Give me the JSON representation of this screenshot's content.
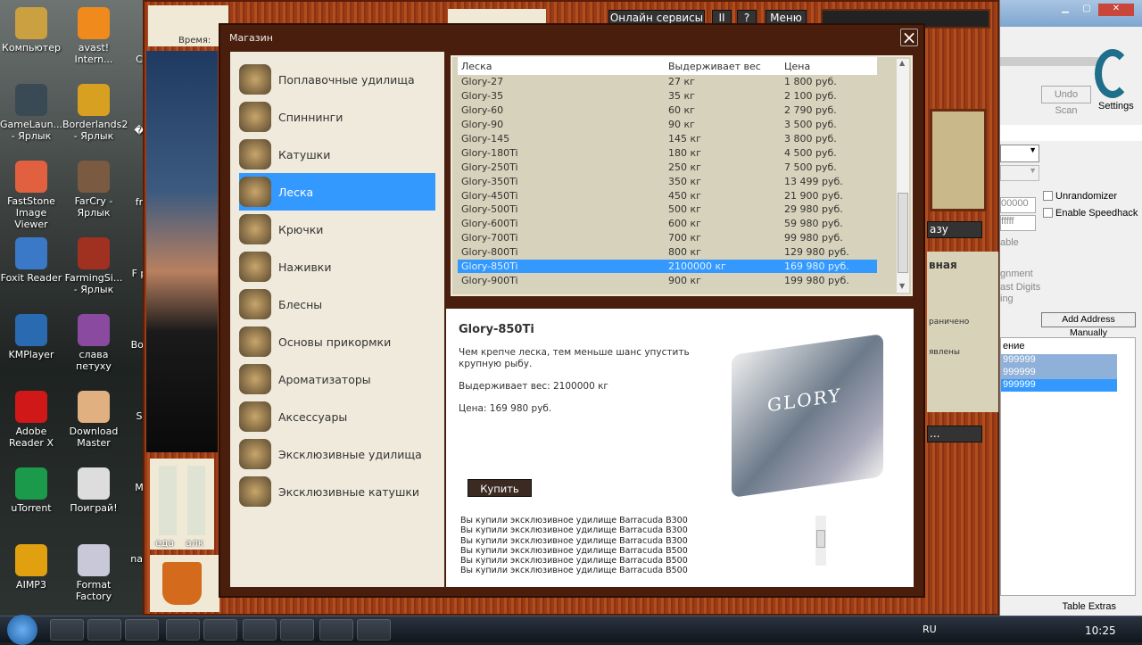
{
  "desktop": {
    "icons": [
      {
        "label": "Компьютер",
        "icon": "computer-icon",
        "color": "#caa040"
      },
      {
        "label": "avast! Intern...",
        "icon": "avast-icon",
        "color": "#f08a1c"
      },
      {
        "label": "GameLaun... - Ярлык",
        "icon": "gamelauncher-icon",
        "color": "#3a4a55"
      },
      {
        "label": "Borderlands2 - Ярлык",
        "icon": "borderlands-icon",
        "color": "#d8a020"
      },
      {
        "label": "FastStone Image Viewer",
        "icon": "faststone-icon",
        "color": "#e06040"
      },
      {
        "label": "FarCry - Ярлык",
        "icon": "farcry-icon",
        "color": "#7a5a40"
      },
      {
        "label": "Foxit Reader",
        "icon": "foxit-icon",
        "color": "#3a78c8"
      },
      {
        "label": "FarmingSi... - Ярлык",
        "icon": "farming-icon",
        "color": "#a03020"
      },
      {
        "label": "KMPlayer",
        "icon": "kmplayer-icon",
        "color": "#2a6ab0"
      },
      {
        "label": "слава петуху",
        "icon": "winrar-icon",
        "color": "#8a4aa0"
      },
      {
        "label": "Adobe Reader X",
        "icon": "adobe-icon",
        "color": "#d01818"
      },
      {
        "label": "Download Master",
        "icon": "download-master-icon",
        "color": "#e0b080"
      },
      {
        "label": "uTorrent",
        "icon": "utorrent-icon",
        "color": "#1a9a4a"
      },
      {
        "label": "Поиграй!",
        "icon": "gamepad-icon",
        "color": "#dddddd"
      },
      {
        "label": "AIMP3",
        "icon": "aimp-icon",
        "color": "#e0a010"
      },
      {
        "label": "Format Factory",
        "icon": "format-factory-icon",
        "color": "#c8c8d8"
      }
    ],
    "partial_labels": [
      "С",
      "�",
      "fr",
      "F p",
      "Bor",
      "S",
      "M",
      "nas"
    ]
  },
  "game": {
    "time_label": "Время:",
    "top": {
      "online": "Онлайн сервисы",
      "pause": "II",
      "help": "?",
      "menu": "Меню"
    },
    "bars": {
      "food": "еда",
      "alcohol": "алк"
    },
    "right": {
      "btn1": "азу",
      "heading": "вная",
      "line1": "раничено",
      "line2": "явлены",
      "btn2": "..."
    }
  },
  "shop": {
    "title": "Магазин",
    "close": "×",
    "categories": [
      {
        "label": "Поплавочные удилища",
        "selected": false
      },
      {
        "label": "Спиннинги",
        "selected": false
      },
      {
        "label": "Катушки",
        "selected": false
      },
      {
        "label": "Леска",
        "selected": true
      },
      {
        "label": "Крючки",
        "selected": false
      },
      {
        "label": "Наживки",
        "selected": false
      },
      {
        "label": "Блесны",
        "selected": false
      },
      {
        "label": "Основы прикормки",
        "selected": false
      },
      {
        "label": "Ароматизаторы",
        "selected": false
      },
      {
        "label": "Аксессуары",
        "selected": false
      },
      {
        "label": "Эксклюзивные удилища",
        "selected": false
      },
      {
        "label": "Эксклюзивные катушки",
        "selected": false
      }
    ],
    "table": {
      "headers": [
        "Леска",
        "Выдерживает вес",
        "Цена"
      ],
      "rows": [
        [
          "Glory-27",
          "27 кг",
          "1 800 руб."
        ],
        [
          "Glory-35",
          "35 кг",
          "2 100 руб."
        ],
        [
          "Glory-60",
          "60 кг",
          "2 790 руб."
        ],
        [
          "Glory-90",
          "90 кг",
          "3 500 руб."
        ],
        [
          "Glory-145",
          "145 кг",
          "3 800 руб."
        ],
        [
          "Glory-180Ti",
          "180 кг",
          "4 500 руб."
        ],
        [
          "Glory-250Ti",
          "250 кг",
          "7 500 руб."
        ],
        [
          "Glory-350Ti",
          "350 кг",
          "13 499 руб."
        ],
        [
          "Glory-450Ti",
          "450 кг",
          "21 900 руб."
        ],
        [
          "Glory-500Ti",
          "500 кг",
          "29 980 руб."
        ],
        [
          "Glory-600Ti",
          "600 кг",
          "59 980 руб."
        ],
        [
          "Glory-700Ti",
          "700 кг",
          "99 980 руб."
        ],
        [
          "Glory-800Ti",
          "800 кг",
          "129 980 руб."
        ],
        [
          "Glory-850Ti",
          "2100000 кг",
          "169 980 руб."
        ],
        [
          "Glory-900Ti",
          "900 кг",
          "199 980 руб."
        ]
      ],
      "selected_index": 13
    },
    "detail": {
      "name": "Glory-850Ti",
      "description": "Чем крепче леска, тем меньше шанс упустить крупную рыбу.",
      "weight": "Выдерживает вес: 2100000 кг",
      "price": "Цена: 169 980 руб.",
      "product_label": "GLORY",
      "buy": "Купить"
    },
    "log": [
      "Вы купили эксклюзивное удилище Barracuda B300",
      "Вы купили эксклюзивное удилище Barracuda B300",
      "Вы купили эксклюзивное удилище Barracuda B300",
      "Вы купили эксклюзивное удилище Barracuda B500",
      "Вы купили эксклюзивное удилище Barracuda B500",
      "Вы купили эксклюзивное удилище Barracuda B500"
    ]
  },
  "cheat_engine": {
    "undo_scan": "Undo Scan",
    "settings": "Settings",
    "hex1": "00000",
    "hex2": "fffff",
    "able": "able",
    "alignment": "gnment",
    "last_digits": "ast Digits",
    "ing": "ing",
    "unrandomizer": "Unrandomizer",
    "speedhack": "Enable Speedhack",
    "add_address": "Add Address Manually",
    "col_value": "ение",
    "values": [
      "999999",
      "999999",
      "999999"
    ],
    "table_extras": "Table Extras"
  },
  "taskbar": {
    "lang": "RU",
    "clock": "10:25",
    "accent": "#3399ff"
  }
}
